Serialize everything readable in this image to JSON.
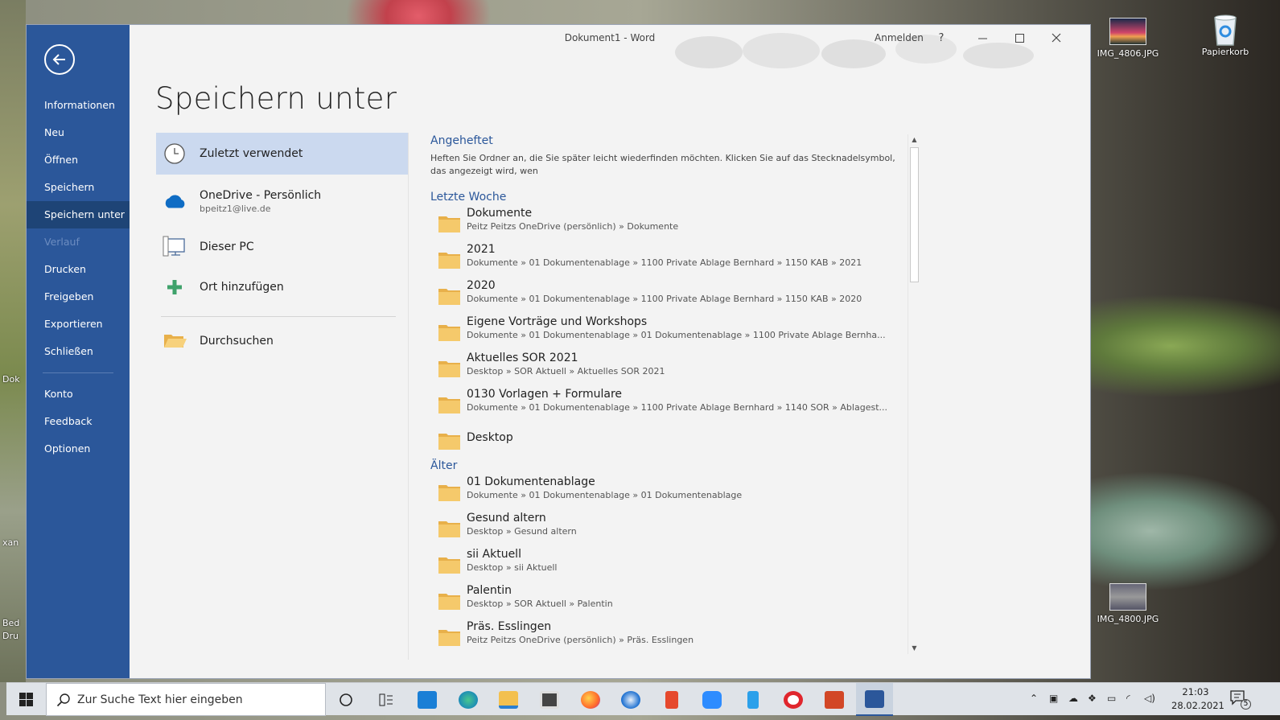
{
  "window": {
    "title": "Dokument1  -  Word",
    "sign_in": "Anmelden",
    "help": "?"
  },
  "backstage": {
    "items": [
      {
        "label": "Informationen",
        "state": "normal"
      },
      {
        "label": "Neu",
        "state": "normal"
      },
      {
        "label": "Öffnen",
        "state": "normal"
      },
      {
        "label": "Speichern",
        "state": "normal"
      },
      {
        "label": "Speichern unter",
        "state": "active"
      },
      {
        "label": "Verlauf",
        "state": "disabled"
      },
      {
        "label": "Drucken",
        "state": "normal"
      },
      {
        "label": "Freigeben",
        "state": "normal"
      },
      {
        "label": "Exportieren",
        "state": "normal"
      },
      {
        "label": "Schließen",
        "state": "normal"
      }
    ],
    "bottom_items": [
      {
        "label": "Konto"
      },
      {
        "label": "Feedback"
      },
      {
        "label": "Optionen"
      }
    ]
  },
  "page": {
    "title": "Speichern unter"
  },
  "locations": {
    "recent": "Zuletzt verwendet",
    "onedrive": "OneDrive - Persönlich",
    "onedrive_email": "bpeitz1@live.de",
    "this_pc": "Dieser PC",
    "add_place": "Ort hinzufügen",
    "browse": "Durchsuchen"
  },
  "pinned": {
    "heading": "Angeheftet",
    "text": "Heften Sie Ordner an, die Sie später leicht wiederfinden möchten. Klicken Sie auf das Stecknadelsymbol, das angezeigt wird, wen"
  },
  "last_week": {
    "heading": "Letzte Woche",
    "folders": [
      {
        "name": "Dokumente",
        "path": "Peitz Peitzs OneDrive (persönlich) » Dokumente"
      },
      {
        "name": "2021",
        "path": "Dokumente » 01 Dokumentenablage » 1100 Private Ablage Bernhard » 1150 KAB » 2021"
      },
      {
        "name": "2020",
        "path": "Dokumente » 01 Dokumentenablage » 1100 Private Ablage Bernhard » 1150 KAB » 2020"
      },
      {
        "name": "Eigene Vorträge und Workshops",
        "path": "Dokumente » 01 Dokumentenablage » 01 Dokumentenablage » 1100 Private Ablage Bernha..."
      },
      {
        "name": "Aktuelles SOR 2021",
        "path": "Desktop » SOR Aktuell » Aktuelles SOR 2021"
      },
      {
        "name": "0130 Vorlagen + Formulare",
        "path": "Dokumente » 01 Dokumentenablage » 1100 Private Ablage Bernhard » 1140 SOR » Ablagest..."
      },
      {
        "name": "Desktop",
        "path": ""
      }
    ]
  },
  "older": {
    "heading": "Älter",
    "folders": [
      {
        "name": "01 Dokumentenablage",
        "path": "Dokumente » 01 Dokumentenablage » 01 Dokumentenablage"
      },
      {
        "name": "Gesund altern",
        "path": "Desktop » Gesund altern"
      },
      {
        "name": "sii Aktuell",
        "path": "Desktop » sii Aktuell"
      },
      {
        "name": "Palentin",
        "path": "Desktop » SOR Aktuell » Palentin"
      },
      {
        "name": "Präs. Esslingen",
        "path": "Peitz Peitzs OneDrive (persönlich) » Präs. Esslingen"
      }
    ]
  },
  "desktop_icons": {
    "img1": "IMG_4806.JPG",
    "recycle": "Papierkorb",
    "img2": "IMG_4800.JPG",
    "cut_left_1": "Dok",
    "cut_left_2": "xan",
    "cut_left_3": "Bed",
    "cut_left_4": "Dru"
  },
  "taskbar": {
    "search_placeholder": "Zur Suche Text hier eingeben",
    "time": "21:03",
    "date": "28.02.2021",
    "notification_count": "5"
  },
  "colors": {
    "accent": "#2b579a",
    "active_location": "#cbd9ef",
    "folder": "#f5c96b"
  }
}
